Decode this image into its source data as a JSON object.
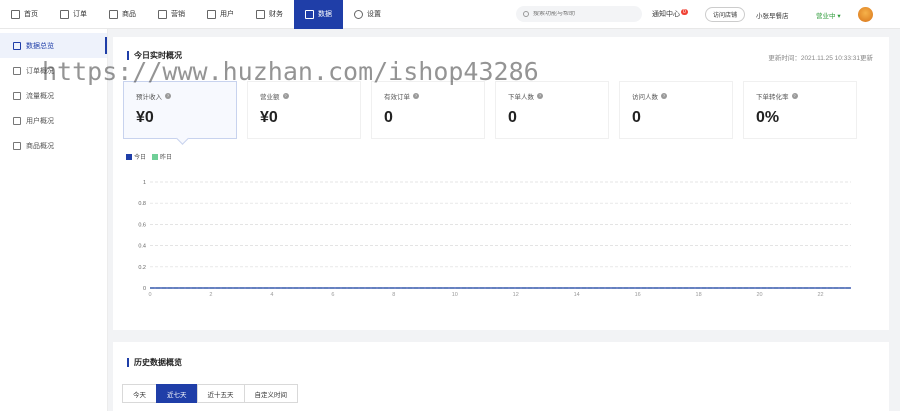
{
  "nav": {
    "items": [
      {
        "label": "首页",
        "icon": "home-icon"
      },
      {
        "label": "订单",
        "icon": "order-icon"
      },
      {
        "label": "商品",
        "icon": "goods-icon"
      },
      {
        "label": "营销",
        "icon": "marketing-icon"
      },
      {
        "label": "用户",
        "icon": "user-icon"
      },
      {
        "label": "财务",
        "icon": "finance-icon"
      },
      {
        "label": "数据",
        "icon": "chart-icon"
      },
      {
        "label": "设置",
        "icon": "settings-icon"
      }
    ],
    "active_index": 6,
    "search_placeholder": "搜索功能与帮助",
    "notify_label": "通知中心",
    "notify_count": "0",
    "visit_shop": "访问店铺",
    "shop_name": "小张早餐店",
    "status": "营业中",
    "accent": "#1f3ea8"
  },
  "sidebar": {
    "items": [
      "数据总览",
      "订单概况",
      "流量概况",
      "用户概况",
      "商品概况"
    ],
    "active_index": 0
  },
  "realtime": {
    "title": "今日实时概况",
    "update_time": "更新时间：2021.11.25 10:33:31更新",
    "stats": [
      {
        "label": "预计收入",
        "value": "¥0"
      },
      {
        "label": "营业额",
        "value": "¥0"
      },
      {
        "label": "有效订单",
        "value": "0"
      },
      {
        "label": "下单人数",
        "value": "0"
      },
      {
        "label": "访问人数",
        "value": "0"
      },
      {
        "label": "下单转化率",
        "value": "0%"
      }
    ],
    "legend": [
      {
        "name": "今日",
        "color": "#1f3ea8"
      },
      {
        "name": "昨日",
        "color": "#6fcf97"
      }
    ]
  },
  "chart_data": {
    "type": "line",
    "x": [
      0,
      1,
      2,
      3,
      4,
      5,
      6,
      7,
      8,
      9,
      10,
      11,
      12,
      13,
      14,
      15,
      16,
      17,
      18,
      19,
      20,
      21,
      22,
      23
    ],
    "xticks": [
      "0",
      "2",
      "4",
      "6",
      "8",
      "10",
      "12",
      "14",
      "16",
      "18",
      "20",
      "22"
    ],
    "yticks": [
      "0",
      "0.2",
      "0.4",
      "0.6",
      "0.8",
      "1"
    ],
    "ylim": [
      0,
      1
    ],
    "series": [
      {
        "name": "今日",
        "values": [
          0,
          0,
          0,
          0,
          0,
          0,
          0,
          0,
          0,
          0,
          0,
          0,
          0,
          0,
          0,
          0,
          0,
          0,
          0,
          0,
          0,
          0,
          0,
          0
        ],
        "color": "#1f3ea8"
      },
      {
        "name": "昨日",
        "values": [
          0,
          0,
          0,
          0,
          0,
          0,
          0,
          0,
          0,
          0,
          0,
          0,
          0,
          0,
          0,
          0,
          0,
          0,
          0,
          0,
          0,
          0,
          0,
          0
        ],
        "color": "#6fcf97"
      }
    ],
    "grid": true
  },
  "history": {
    "title": "历史数据概览",
    "tabs": [
      "今天",
      "近七天",
      "近十五天",
      "自定义时间"
    ],
    "active_index": 1
  },
  "watermark": "https://www.huzhan.com/ishop43286"
}
